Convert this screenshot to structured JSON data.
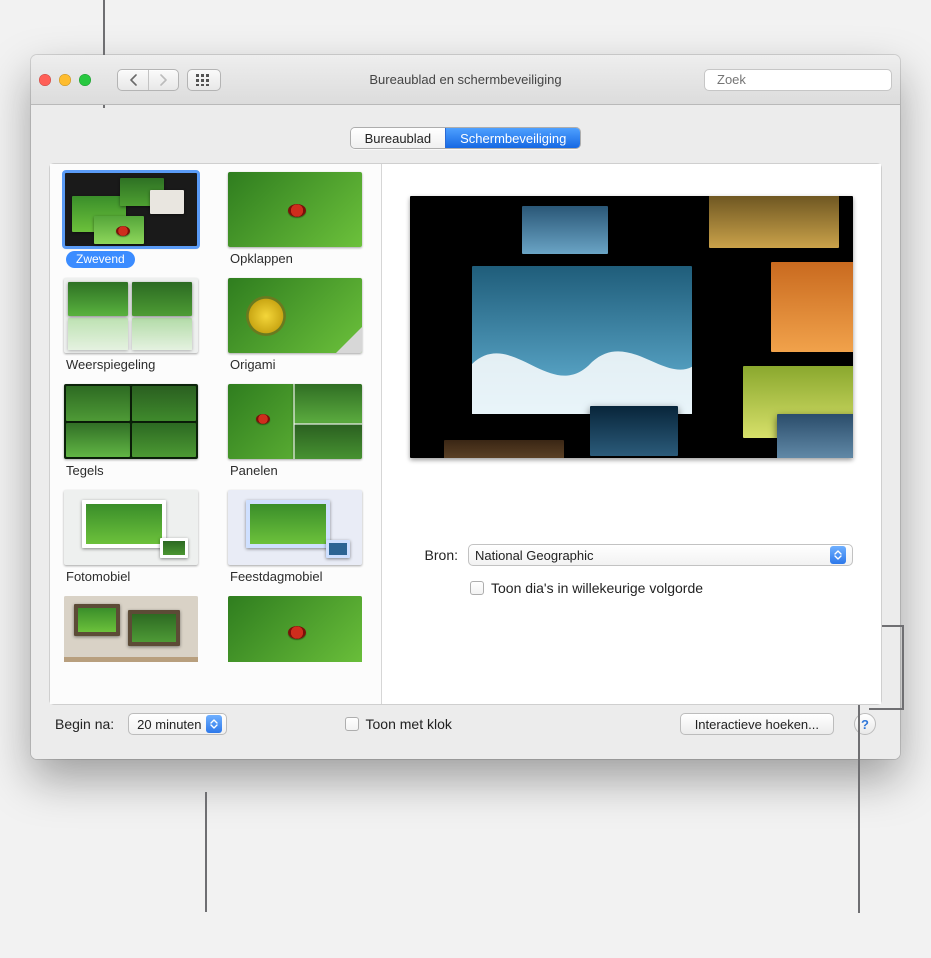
{
  "window": {
    "title": "Bureaublad en schermbeveiliging",
    "search_placeholder": "Zoek"
  },
  "tabs": {
    "items": [
      "Bureaublad",
      "Schermbeveiliging"
    ],
    "active_index": 1
  },
  "screensavers": [
    {
      "label": "Zwevend",
      "selected": true
    },
    {
      "label": "Opklappen",
      "selected": false
    },
    {
      "label": "Weerspiegeling",
      "selected": false
    },
    {
      "label": "Origami",
      "selected": false
    },
    {
      "label": "Tegels",
      "selected": false
    },
    {
      "label": "Panelen",
      "selected": false
    },
    {
      "label": "Fotomobiel",
      "selected": false
    },
    {
      "label": "Feestdagmobiel",
      "selected": false
    }
  ],
  "source": {
    "label": "Bron:",
    "value": "National Geographic"
  },
  "random": {
    "label": "Toon dia's in willekeurige volgorde",
    "checked": false
  },
  "start": {
    "label": "Begin na:",
    "value": "20 minuten"
  },
  "clock": {
    "label": "Toon met klok",
    "checked": false
  },
  "hotcorners": {
    "label": "Interactieve hoeken..."
  },
  "help_glyph": "?"
}
